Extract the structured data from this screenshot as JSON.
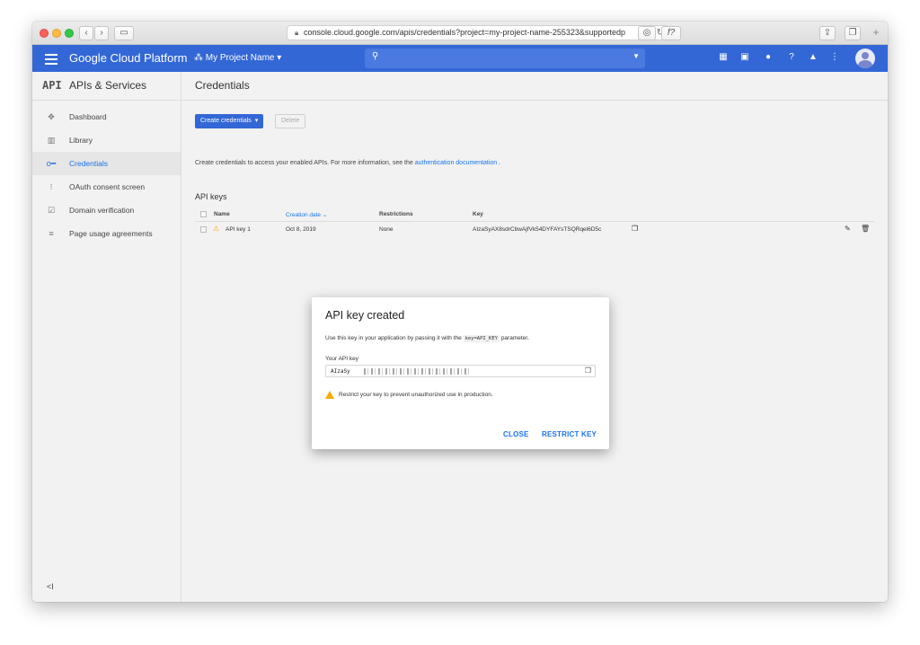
{
  "browser": {
    "url": "console.cloud.google.com/apis/credentials?project=my-project-name-255323&supportedp",
    "font_button": "f?"
  },
  "topbar": {
    "brand": "Google Cloud Platform",
    "project_name": "My Project Name",
    "accent": "#3367d6"
  },
  "sidebar": {
    "logo": "API",
    "title": "APIs & Services",
    "items": [
      {
        "label": "Dashboard",
        "icon": "dashboard-icon"
      },
      {
        "label": "Library",
        "icon": "library-icon"
      },
      {
        "label": "Credentials",
        "icon": "key-icon",
        "active": true
      },
      {
        "label": "OAuth consent screen",
        "icon": "consent-icon"
      },
      {
        "label": "Domain verification",
        "icon": "domain-icon"
      },
      {
        "label": "Page usage agreements",
        "icon": "agreements-icon"
      }
    ],
    "collapse": "<I"
  },
  "main": {
    "title": "Credentials",
    "create_button": "Create credentials",
    "delete_button": "Delete",
    "info_text": "Create credentials to access your enabled APIs. For more information, see the",
    "info_link": "authentication documentation",
    "info_end": ".",
    "section_title": "API keys",
    "table": {
      "headers": [
        "Name",
        "Creation date",
        "Restrictions",
        "Key"
      ],
      "rows": [
        {
          "name": "API key 1",
          "date": "Oct 8, 2019",
          "restrictions": "None",
          "key": "AIzaSyAX8sdrCbwAjfVk54DYFAYsTSQRqel6D5c"
        }
      ]
    }
  },
  "modal": {
    "title": "API key created",
    "desc_before": "Use this key in your application by passing it with the",
    "desc_code": "key=API_KEY",
    "desc_after": "parameter.",
    "key_label": "Your API key",
    "key_prefix": "AIzaSy",
    "warning": "Restrict your key to prevent unauthorized use in production.",
    "close_label": "CLOSE",
    "restrict_label": "RESTRICT KEY"
  }
}
